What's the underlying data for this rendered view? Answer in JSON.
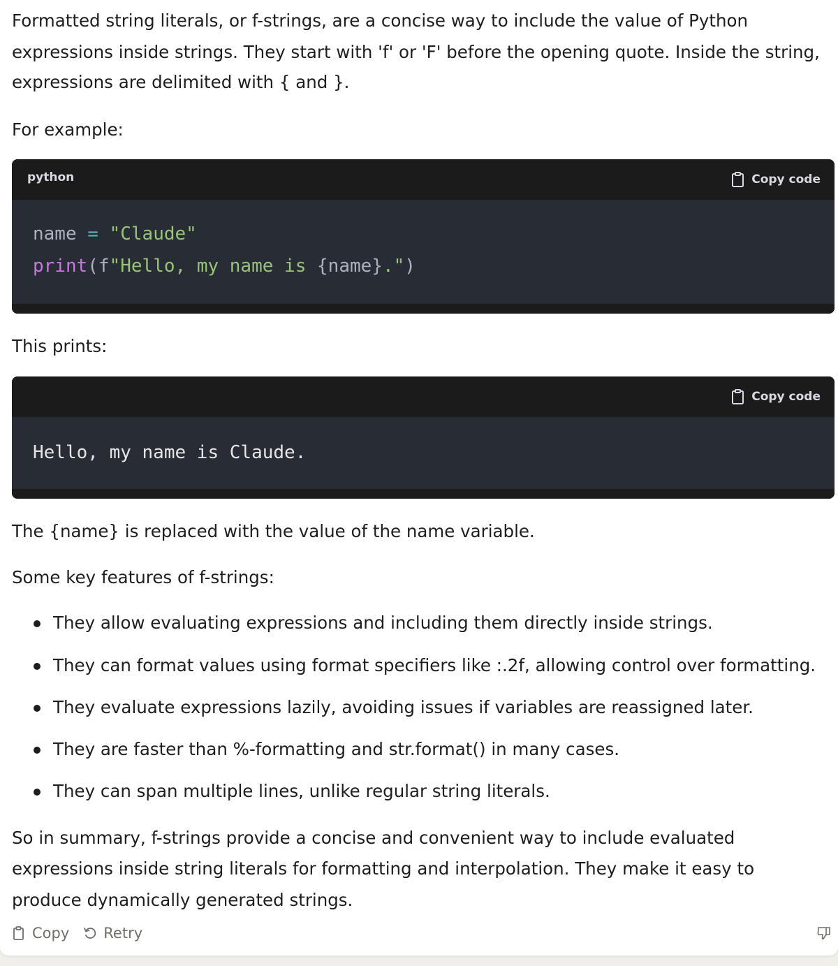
{
  "message": {
    "intro": [
      "Formatted string literals, or f-strings, are a concise way to include the value of Python",
      "expressions inside strings. They start with 'f' or 'F' before the opening quote. Inside the string,",
      "expressions are delimited with { and }."
    ],
    "for_example": "For example:",
    "code_block_1": {
      "language": "python",
      "copy_label": "Copy code",
      "line1": {
        "ident": "name",
        "op": "=",
        "str": "\"Claude\""
      },
      "line2": {
        "fn": "print",
        "open": "(",
        "fprefix": "f",
        "fstring": "\"Hello, my name is ",
        "interp": "{name}",
        "tail": ".\"",
        "close": ")"
      }
    },
    "this_prints": "This prints:",
    "code_block_2": {
      "copy_label": "Copy code",
      "output": "Hello, my name is Claude."
    },
    "explanation": "The {name} is replaced with the value of the name variable.",
    "features_heading": "Some key features of f-strings:",
    "features": [
      "They allow evaluating expressions and including them directly inside strings.",
      "They can format values using format specifiers like :.2f, allowing control over formatting.",
      "They evaluate expressions lazily, avoiding issues if variables are reassigned later.",
      "They are faster than %-formatting and str.format() in many cases.",
      "They can span multiple lines, unlike regular string literals."
    ],
    "summary": [
      "So in summary, f-strings provide a concise and convenient way to include evaluated",
      "expressions inside string literals for formatting and interpolation. They make it easy to",
      "produce dynamically generated strings."
    ]
  },
  "actions": {
    "copy_label": "Copy",
    "retry_label": "Retry"
  },
  "icons": {
    "copy": "clipboard-icon",
    "retry": "retry-icon",
    "feedback": "thumbs-down-icon"
  },
  "colors": {
    "text": "#1f1e1d",
    "code_bg": "#282c34",
    "code_header_bg": "#1b1b1b",
    "syntax_string": "#98c379",
    "syntax_keyword": "#c678dd",
    "syntax_operator": "#56b6c2"
  }
}
